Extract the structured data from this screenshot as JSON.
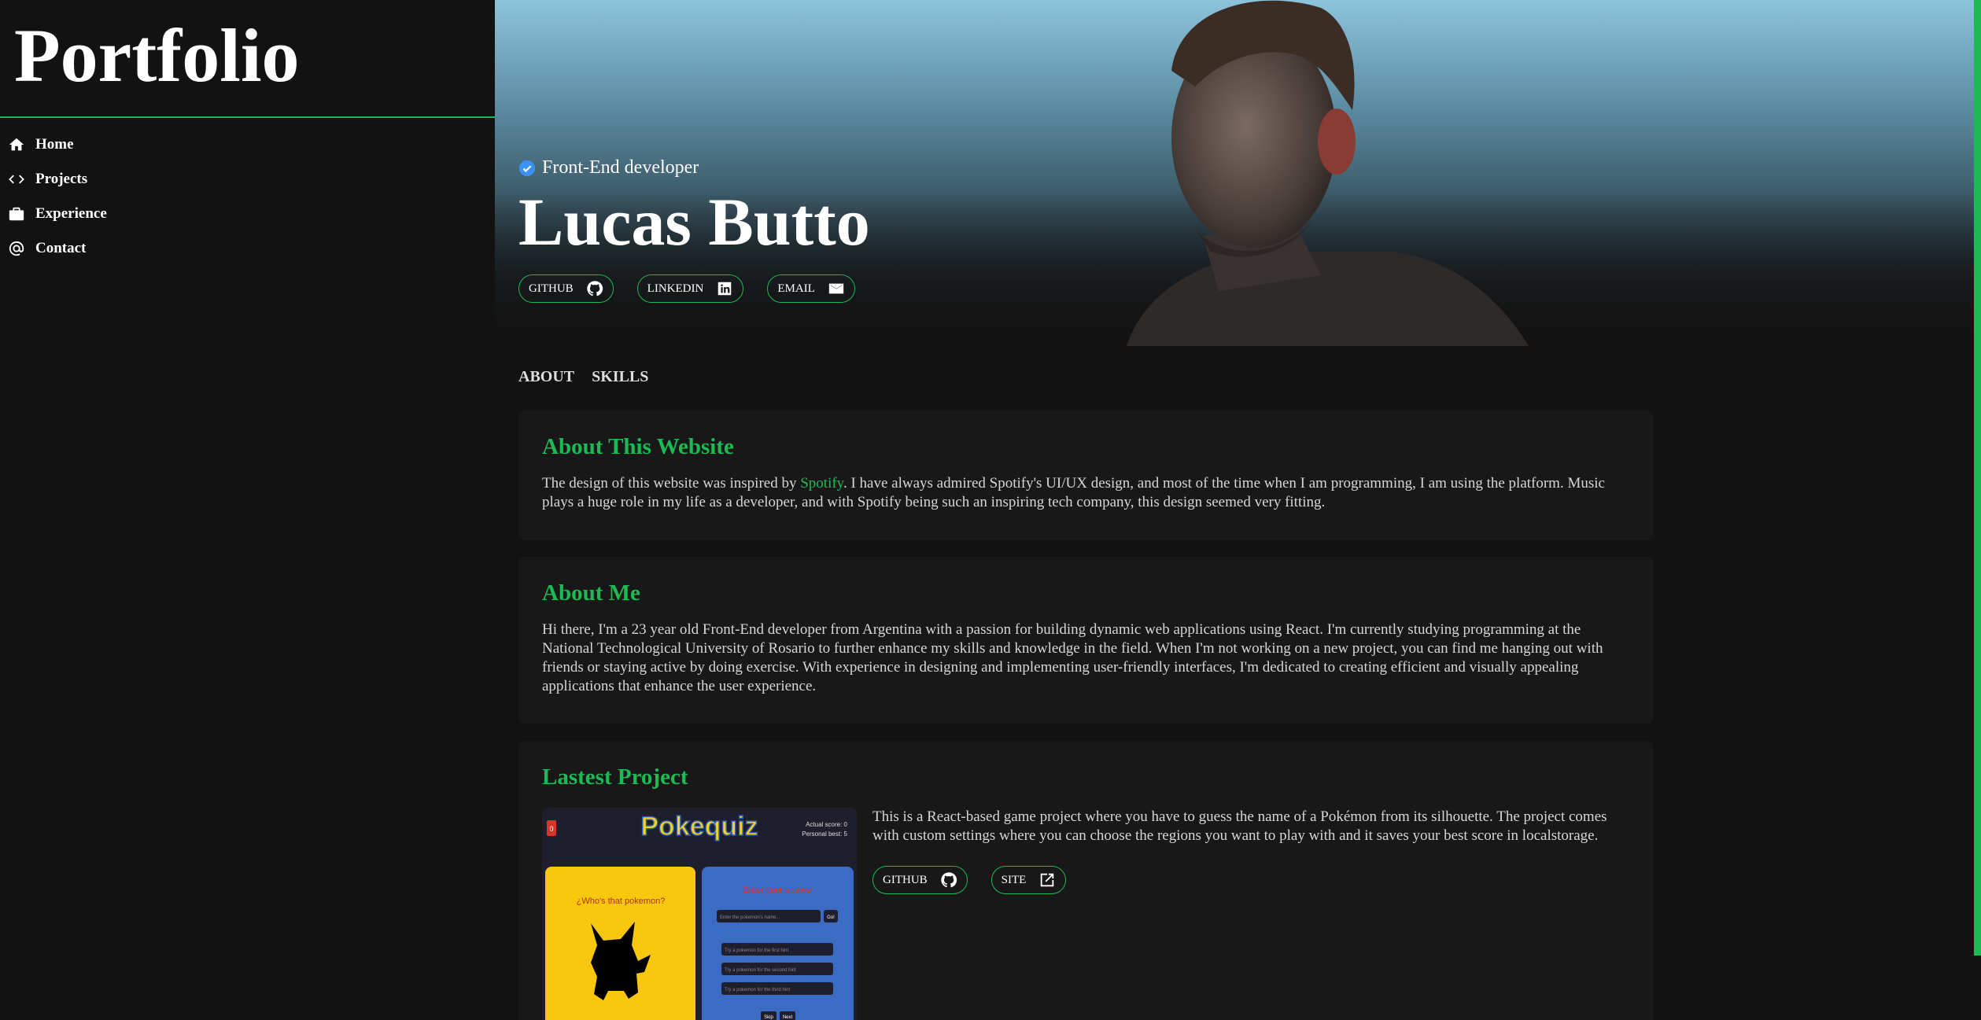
{
  "sidebar": {
    "logo": "Portfolio",
    "items": [
      {
        "label": "Home",
        "icon": "home-icon"
      },
      {
        "label": "Projects",
        "icon": "code-icon"
      },
      {
        "label": "Experience",
        "icon": "briefcase-icon"
      },
      {
        "label": "Contact",
        "icon": "at-icon"
      }
    ]
  },
  "hero": {
    "role": "Front-End developer",
    "name": "Lucas Butto",
    "links": [
      {
        "label": "GITHUB",
        "icon": "github-icon"
      },
      {
        "label": "LINKEDIN",
        "icon": "linkedin-icon"
      },
      {
        "label": "EMAIL",
        "icon": "email-icon"
      }
    ]
  },
  "tabs": [
    "ABOUT",
    "SKILLS"
  ],
  "about_website": {
    "title": "About This Website",
    "text_before": "The design of this website was inspired by ",
    "link": "Spotify",
    "text_after": ". I have always admired Spotify's UI/UX design, and most of the time when I am programming, I am using the platform. Music plays a huge role in my life as a developer, and with Spotify being such an inspiring tech company, this design seemed very fitting."
  },
  "about_me": {
    "title": "About Me",
    "text": "Hi there, I'm a 23 year old Front-End developer from Argentina with a passion for building dynamic web applications using React. I'm currently studying programming at the National Technological University of Rosario to further enhance my skills and knowledge in the field. When I'm not working on a new project, you can find me hanging out with friends or staying active by doing exercise. With experience in designing and implementing user-friendly interfaces, I'm dedicated to creating efficient and visually appealing applications that enhance the user experience."
  },
  "latest_project": {
    "title": "Lastest Project",
    "description": "This is a React-based game project where you have to guess the name of a Pokémon from its silhouette. The project comes with custom settings where you can choose the regions you want to play with and it saves your best score in localstorage.",
    "links": [
      {
        "label": "GITHUB",
        "icon": "github-icon"
      },
      {
        "label": "SITE",
        "icon": "external-link-icon"
      }
    ],
    "screenshot": {
      "logo": "Pokequiz",
      "badge": "0",
      "score": "Actual score: 0",
      "best": "Personal best: 5",
      "question": "¿Who's that pokemon?",
      "answer_title": "Enter your answer",
      "input_placeholder": "Enter the pokemon's name...",
      "go": "Go!",
      "hints": [
        "Try a pokemon for the first hint",
        "Try a pokemon for the second hint",
        "Try a pokemon for the third hint"
      ],
      "buttons": [
        "Skip",
        "Next"
      ]
    }
  },
  "colors": {
    "accent": "#1db954",
    "background": "#121212",
    "card": "#181818"
  }
}
